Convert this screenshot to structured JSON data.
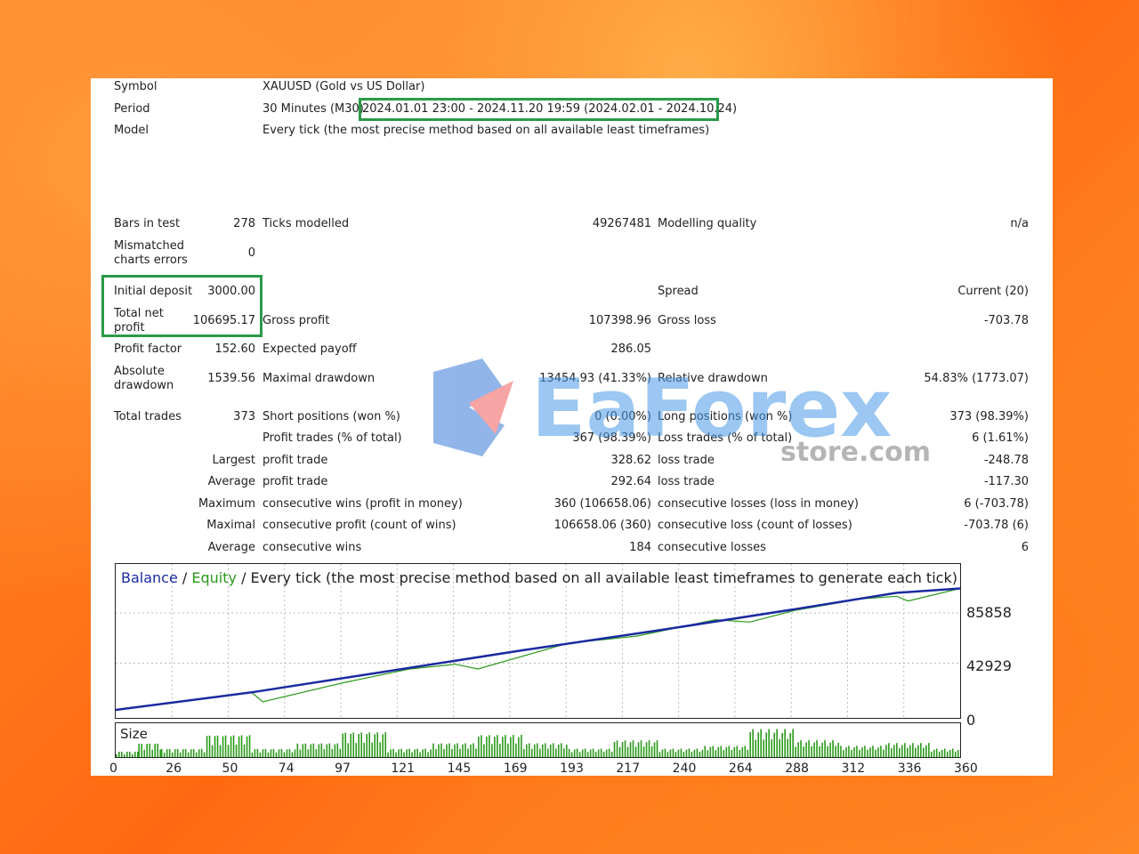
{
  "header": {
    "symbol_label": "Symbol",
    "symbol_value": "XAUUSD (Gold vs US Dollar)",
    "period_label": "Period",
    "period_prefix": "30 Minutes (M30)",
    "period_range": "2024.01.01 23:00 - 2024.11.20 19:59 (2024.02.01 - 2024.10.24)",
    "model_label": "Model",
    "model_value": "Every tick (the most precise method based on all available least timeframes)"
  },
  "stats": {
    "bars_label": "Bars in test",
    "bars_value": "278",
    "ticks_label": "Ticks modelled",
    "ticks_value": "49267481",
    "quality_label": "Modelling quality",
    "quality_value": "n/a",
    "mismatch_label": "Mismatched charts errors",
    "mismatch_value": "0",
    "deposit_label": "Initial deposit",
    "deposit_value": "3000.00",
    "spread_label": "Spread",
    "spread_value": "Current (20)",
    "netprofit_label": "Total net profit",
    "netprofit_value": "106695.17",
    "grossprofit_label": "Gross profit",
    "grossprofit_value": "107398.96",
    "grossloss_label": "Gross loss",
    "grossloss_value": "-703.78",
    "pf_label": "Profit factor",
    "pf_value": "152.60",
    "payoff_label": "Expected payoff",
    "payoff_value": "286.05",
    "absdd_label": "Absolute drawdown",
    "absdd_value": "1539.56",
    "maxdd_label": "Maximal drawdown",
    "maxdd_value": "13454.93 (41.33%)",
    "reldd_label": "Relative drawdown",
    "reldd_value": "54.83% (1773.07)",
    "trades_label": "Total trades",
    "trades_value": "373",
    "short_label": "Short positions (won %)",
    "short_value": "0 (0.00%)",
    "long_label": "Long positions (won %)",
    "long_value": "373 (98.39%)",
    "ptrades_label": "Profit trades (% of total)",
    "ptrades_value": "367 (98.39%)",
    "ltrades_label": "Loss trades (% of total)",
    "ltrades_value": "6 (1.61%)",
    "largest_label": "Largest",
    "largest_profit_label": "profit trade",
    "largest_profit_value": "328.62",
    "largest_loss_label": "loss trade",
    "largest_loss_value": "-248.78",
    "average_label": "Average",
    "average_profit_label": "profit trade",
    "average_profit_value": "292.64",
    "average_loss_label": "loss trade",
    "average_loss_value": "-117.30",
    "maximum_label": "Maximum",
    "max_wins_label": "consecutive wins (profit in money)",
    "max_wins_value": "360 (106658.06)",
    "max_losses_label": "consecutive losses (loss in money)",
    "max_losses_value": "6 (-703.78)",
    "maximal_label": "Maximal",
    "mxl_profit_label": "consecutive profit (count of wins)",
    "mxl_profit_value": "106658.06 (360)",
    "mxl_loss_label": "consecutive loss (count of losses)",
    "mxl_loss_value": "-703.78 (6)",
    "avg2_label": "Average",
    "avg_wins_label": "consecutive wins",
    "avg_wins_value": "184",
    "avg_losses_label": "consecutive losses",
    "avg_losses_value": "6"
  },
  "watermark": {
    "brand": "EaForex",
    "domain": "store.com"
  },
  "chart": {
    "balance_label": "Balance",
    "sep1": "/",
    "equity_label": "Equity",
    "sep2": "/ Every tick (the most precise method based on all available least timeframes to generate each tick)",
    "size_label": "Size",
    "balance_color": "#1a2aa0",
    "equity_color": "#2a9a1a"
  },
  "chart_data": {
    "type": "line",
    "y_ticks": [
      "85858",
      "42929",
      "0"
    ],
    "x_ticks": [
      "0",
      "26",
      "50",
      "74",
      "97",
      "121",
      "145",
      "169",
      "193",
      "217",
      "240",
      "264",
      "288",
      "312",
      "336",
      "360"
    ],
    "ylim": [
      0,
      120000
    ],
    "xlim": [
      0,
      373
    ],
    "series": [
      {
        "name": "Balance",
        "color": "#1a2aa0",
        "x": [
          0,
          60,
          120,
          180,
          240,
          300,
          345,
          373
        ],
        "values": [
          3000,
          18000,
          36000,
          54000,
          71000,
          89000,
          103000,
          106695
        ]
      },
      {
        "name": "Equity",
        "color": "#2a9a1a",
        "x": [
          0,
          40,
          60,
          65,
          100,
          130,
          150,
          160,
          200,
          230,
          265,
          280,
          300,
          330,
          345,
          350,
          373
        ],
        "values": [
          3000,
          13000,
          18000,
          10000,
          26000,
          38000,
          42000,
          38000,
          60000,
          66000,
          80000,
          78000,
          88000,
          98000,
          100000,
          96000,
          106695
        ]
      }
    ],
    "size_series": {
      "x": [
        0,
        10,
        20,
        40,
        60,
        80,
        100,
        120,
        140,
        160,
        180,
        200,
        220,
        240,
        260,
        280,
        300,
        320,
        340,
        360,
        373
      ],
      "values": [
        0.2,
        0.5,
        0.3,
        0.8,
        0.3,
        0.5,
        0.9,
        0.3,
        0.5,
        0.8,
        0.5,
        0.3,
        0.6,
        0.3,
        0.4,
        1.0,
        0.6,
        0.4,
        0.5,
        0.3,
        0.1
      ]
    }
  }
}
